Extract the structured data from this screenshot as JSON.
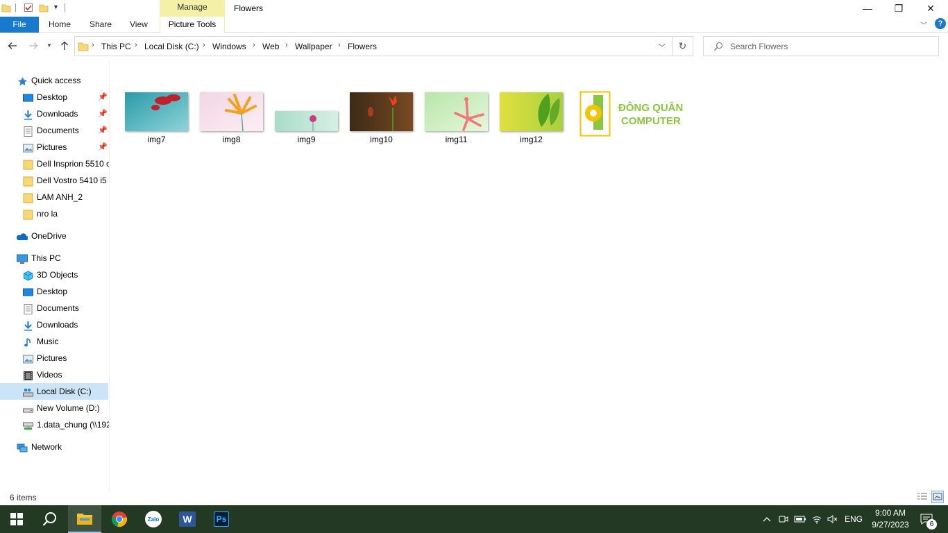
{
  "window": {
    "title": "Flowers",
    "contextual_group": "Manage",
    "minimize_icon": "—",
    "restore_icon": "❐",
    "close_icon": "✕"
  },
  "ribbon": {
    "tabs": [
      {
        "label": "File"
      },
      {
        "label": "Home"
      },
      {
        "label": "Share"
      },
      {
        "label": "View"
      },
      {
        "label": "Picture Tools"
      }
    ],
    "help_icon": "?"
  },
  "address": {
    "breadcrumbs": [
      "This PC",
      "Local Disk (C:)",
      "Windows",
      "Web",
      "Wallpaper",
      "Flowers"
    ]
  },
  "search": {
    "placeholder": "Search Flowers"
  },
  "nav": {
    "quick_access": {
      "label": "Quick access",
      "items": [
        {
          "label": "Desktop",
          "icon": "desktop-icon",
          "pinned": true
        },
        {
          "label": "Downloads",
          "icon": "downloads-icon",
          "pinned": true
        },
        {
          "label": "Documents",
          "icon": "documents-icon",
          "pinned": true
        },
        {
          "label": "Pictures",
          "icon": "pictures-icon",
          "pinned": true
        },
        {
          "label": "Dell Insprion 5510 c",
          "icon": "folder-icon",
          "pinned": false
        },
        {
          "label": "Dell Vostro 5410 i5",
          "icon": "folder-icon",
          "pinned": false
        },
        {
          "label": "LAM ANH_2",
          "icon": "folder-icon",
          "pinned": false
        },
        {
          "label": "nro la",
          "icon": "folder-icon",
          "pinned": false
        }
      ]
    },
    "onedrive": {
      "label": "OneDrive"
    },
    "this_pc": {
      "label": "This PC",
      "items": [
        {
          "label": "3D Objects",
          "icon": "3d-objects-icon"
        },
        {
          "label": "Desktop",
          "icon": "desktop-icon"
        },
        {
          "label": "Documents",
          "icon": "documents-icon"
        },
        {
          "label": "Downloads",
          "icon": "downloads-icon"
        },
        {
          "label": "Music",
          "icon": "music-icon"
        },
        {
          "label": "Pictures",
          "icon": "pictures-icon"
        },
        {
          "label": "Videos",
          "icon": "videos-icon"
        },
        {
          "label": "Local Disk (C:)",
          "icon": "local-disk-icon",
          "selected": true
        },
        {
          "label": "New Volume (D:)",
          "icon": "drive-icon"
        },
        {
          "label": "1.data_chung (\\\\192",
          "icon": "network-drive-icon"
        }
      ]
    },
    "network": {
      "label": "Network"
    }
  },
  "files": [
    {
      "name": "img7",
      "colors": [
        "#2a9aa8",
        "#8ed4d8",
        "#c0202c"
      ]
    },
    {
      "name": "img8",
      "colors": [
        "#f3d6e4",
        "#fbeef4",
        "#f4a020"
      ]
    },
    {
      "name": "img9",
      "colors": [
        "#a9dcc8",
        "#d6efe4",
        "#d03a7a"
      ]
    },
    {
      "name": "img10",
      "colors": [
        "#3a2a18",
        "#7a4a20",
        "#e84020"
      ]
    },
    {
      "name": "img11",
      "colors": [
        "#b8e6a8",
        "#e6f6dc",
        "#f07878"
      ]
    },
    {
      "name": "img12",
      "colors": [
        "#e0e040",
        "#a8d040",
        "#50a020"
      ]
    }
  ],
  "watermark": {
    "line1": "ĐÔNG QUÂN",
    "line2": "COMPUTER",
    "color": "#8cc63f",
    "frame_color": "#f5c400"
  },
  "status": {
    "item_count": "6 items"
  },
  "taskbar": {
    "apps": [
      "start-icon",
      "search-icon",
      "file-explorer-icon",
      "chrome-icon",
      "zalo-icon",
      "word-icon",
      "photoshop-icon"
    ],
    "zalo_label": "Zalo",
    "word_label": "W",
    "ps_label": "Ps",
    "language": "ENG",
    "time": "9:00 AM",
    "date": "9/27/2023",
    "notification_count": "6"
  },
  "colors": {
    "accent": "#1979ca",
    "taskbar": "#233924",
    "selected": "#cce4f7",
    "manage_tab": "#f5f0a8"
  }
}
